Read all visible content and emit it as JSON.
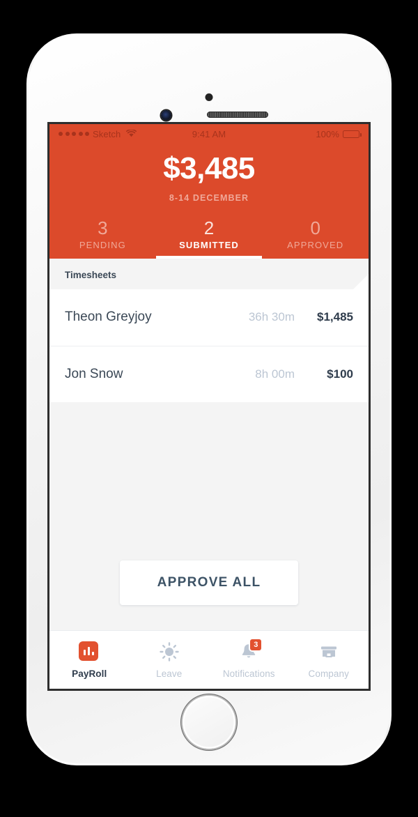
{
  "status_bar": {
    "carrier": "Sketch",
    "time": "9:41 AM",
    "battery_percent": "100%",
    "signal_icon": "signal-dots-icon",
    "wifi_icon": "wifi-icon",
    "battery_icon": "battery-full-icon"
  },
  "header": {
    "amount": "$3,485",
    "period": "8-14 DECEMBER",
    "tabs": [
      {
        "count": "3",
        "label": "PENDING",
        "active": false
      },
      {
        "count": "2",
        "label": "SUBMITTED",
        "active": true
      },
      {
        "count": "0",
        "label": "APPROVED",
        "active": false
      }
    ]
  },
  "list": {
    "section_title": "Timesheets",
    "rows": [
      {
        "name": "Theon Greyjoy",
        "hours": "36h 30m",
        "amount": "$1,485"
      },
      {
        "name": "Jon Snow",
        "hours": "8h 00m",
        "amount": "$100"
      }
    ]
  },
  "actions": {
    "approve_all_label": "APPROVE ALL"
  },
  "tab_bar": {
    "items": [
      {
        "label": "PayRoll",
        "icon": "bar-chart-icon",
        "active": true,
        "badge": null
      },
      {
        "label": "Leave",
        "icon": "sun-icon",
        "active": false,
        "badge": null
      },
      {
        "label": "Notifications",
        "icon": "bell-icon",
        "active": false,
        "badge": "3"
      },
      {
        "label": "Company",
        "icon": "storefront-icon",
        "active": false,
        "badge": null
      }
    ]
  },
  "colors": {
    "brand_orange": "#dc4a2b",
    "accent_orange": "#e2512f",
    "text_dark": "#2f3c4c",
    "text_muted": "#bcc6d3",
    "screen_bg": "#f4f4f4"
  }
}
